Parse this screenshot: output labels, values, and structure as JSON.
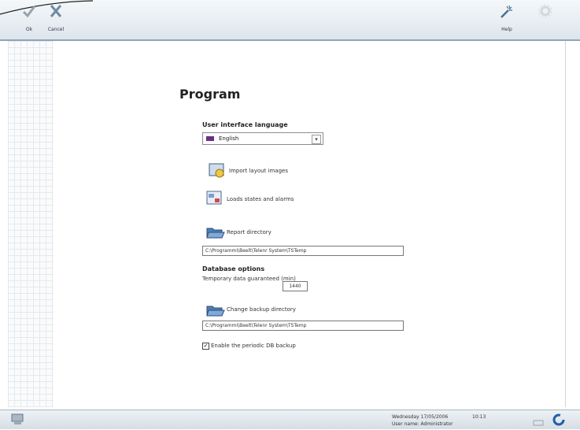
{
  "toolbar": {
    "ok_label": "Ok",
    "cancel_label": "Cancel",
    "help_label": "Help",
    "ok_icon": "check-icon",
    "cancel_icon": "close-icon",
    "help_icon": "magic-wand-icon",
    "disabled_icon": "gear-icon"
  },
  "page": {
    "title": "Program"
  },
  "language": {
    "heading": "User interface language",
    "selected": "English"
  },
  "actions": {
    "import_label": "Import layout images",
    "states_label": "Loads states and alarms"
  },
  "report": {
    "button_label": "Report directory",
    "path": "C:\\Programmi\\Beelt\\Telenr System\\TSTemp"
  },
  "database": {
    "heading": "Database options",
    "temp_label": "Temporary data guaranteed (min)",
    "temp_value": "1440",
    "backup_button": "Change backup directory",
    "backup_path": "C:\\Programmi\\Beelt\\Telenr System\\TSTemp",
    "periodic_label": "Enable the periodic DB backup",
    "periodic_checked": true
  },
  "status": {
    "date": "Wednesday  17/05/2006",
    "time": "10:13",
    "user": "User name: Administrator"
  }
}
